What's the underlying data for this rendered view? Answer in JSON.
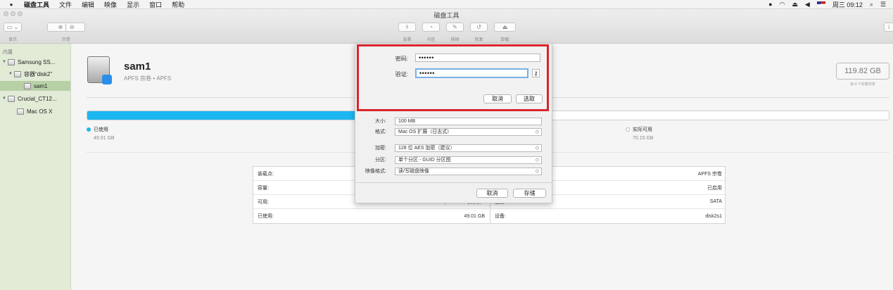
{
  "menubar": {
    "items": [
      "磁盘工具",
      "文件",
      "编辑",
      "映像",
      "显示",
      "窗口",
      "帮助"
    ],
    "clock": "周三 09:12"
  },
  "window": {
    "title": "磁盘工具",
    "toolbar": {
      "view_label": "显示",
      "volume_label": "宗卷",
      "rescue_label": "急救",
      "partition_label": "分区",
      "erase_label": "抹掉",
      "restore_label": "恢复",
      "unmount_label": "卸载"
    }
  },
  "sidebar": {
    "header": "内置",
    "items": [
      {
        "label": "Samsung SS..."
      },
      {
        "label": "容器“disk2”"
      },
      {
        "label": "sam1"
      },
      {
        "label": "Crucial_CT12..."
      },
      {
        "label": "Mac OS X"
      }
    ]
  },
  "volume": {
    "name": "sam1",
    "subtitle": "APFS 宗卷 • APFS",
    "capacity": "119.82 GB",
    "capacity_note": "由 4 个宗卷共享",
    "used_fraction": 0.41
  },
  "usage": {
    "used_label": "已使用",
    "used_value": "49.01 GB",
    "free_label": "实际可用",
    "free_value": "70.15 GB",
    "used_color": "#1cb7f1"
  },
  "info": {
    "left": [
      {
        "label": "装载点:",
        "value": ""
      },
      {
        "label": "容量:",
        "value": ""
      },
      {
        "label": "可用:",
        "value": "73.93 GB（3.78 GB 可清除）"
      },
      {
        "label": "已使用:",
        "value": "49.01 GB"
      }
    ],
    "right": [
      {
        "label": "",
        "value": "APFS 宗卷"
      },
      {
        "label": "",
        "value": "已启用"
      },
      {
        "label": "连接:",
        "value": "SATA"
      },
      {
        "label": "设备:",
        "value": "disk2s1"
      }
    ]
  },
  "sheet": {
    "size_label": "大小:",
    "size_value": "100 MB",
    "format_label": "格式:",
    "format_value": "Mac OS 扩展（日志式）",
    "encryption_label": "加密:",
    "encryption_value": "128 位 AES 加密（建议）",
    "partition_label": "分区:",
    "partition_value": "单个分区 - GUID 分区图",
    "image_format_label": "映像格式:",
    "image_format_value": "读/写磁盘映像",
    "cancel": "取消",
    "save": "存储"
  },
  "password_dialog": {
    "password_label": "密码:",
    "password_value": "••••••",
    "verify_label": "验证:",
    "verify_value": "••••••",
    "cancel": "取消",
    "choose": "选取",
    "highlight_color": "#d9252b"
  }
}
